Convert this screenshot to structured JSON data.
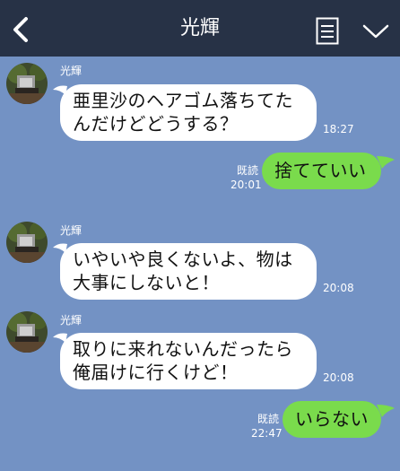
{
  "header": {
    "title": "光輝",
    "back_icon": "chevron-left-icon",
    "notes_icon": "notes-icon",
    "menu_icon": "chevron-down-icon",
    "background": "#273246"
  },
  "chat": {
    "background": "#7392c4",
    "incoming_bubble_color": "#ffffff",
    "outgoing_bubble_color": "#7adb4c",
    "messages": [
      {
        "direction": "in",
        "sender": "光輝",
        "lines": [
          "亜里沙のヘアゴム落ちてた",
          "んだけどどうする？"
        ],
        "time": "18:27"
      },
      {
        "direction": "out",
        "read": "既読",
        "lines": [
          "捨てていい"
        ],
        "time": "20:01"
      },
      {
        "direction": "in",
        "sender": "光輝",
        "lines": [
          "いやいや良くないよ、物は",
          "大事にしないと！"
        ],
        "time": "20:08"
      },
      {
        "direction": "in",
        "sender": "光輝",
        "lines": [
          "取りに来れないんだったら",
          "俺届けに行くけど！"
        ],
        "time": "20:08"
      },
      {
        "direction": "out",
        "read": "既読",
        "lines": [
          "いらない"
        ],
        "time": "22:47"
      }
    ]
  }
}
